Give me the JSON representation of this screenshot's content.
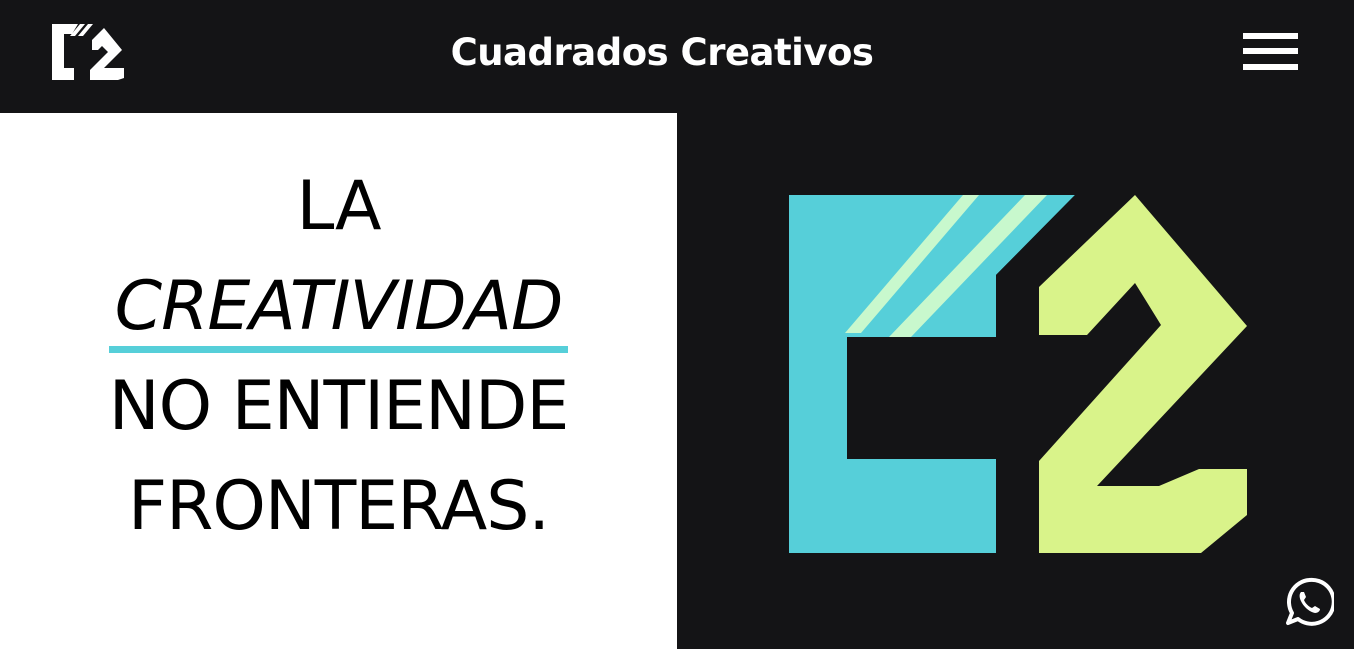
{
  "brand": {
    "name": "Cuadrados Creativos",
    "accent_cyan": "#56cfd9",
    "accent_lime": "#d9f38a",
    "accent_mint": "#c8f8cd",
    "dark": "#141416"
  },
  "header": {
    "title": "Cuadrados Creativos",
    "logo_icon": "c2-logo-icon",
    "menu_icon": "hamburger-menu-icon"
  },
  "hero": {
    "line1": "LA",
    "line2": "CREATIVIDAD",
    "line3": "NO ENTIENDE",
    "line4": "FRONTERAS.",
    "logo_icon": "c2-logo-icon"
  },
  "floating": {
    "whatsapp_icon": "whatsapp-icon"
  }
}
